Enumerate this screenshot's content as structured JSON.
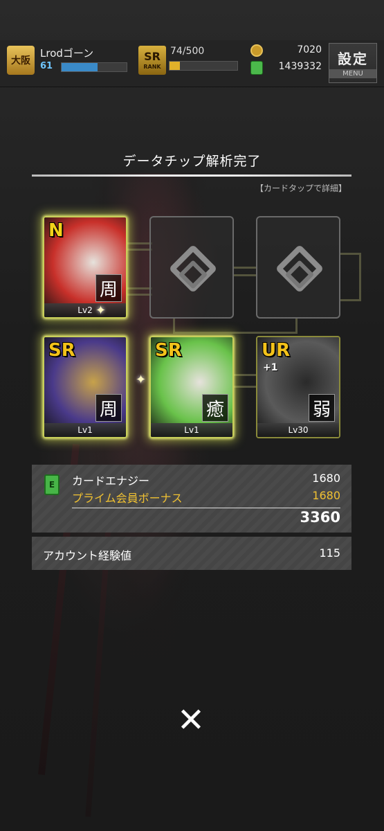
{
  "header": {
    "rank_badge": "大阪",
    "player_name": "Lrodゴーン",
    "level": "61",
    "xp_fraction": 0.55,
    "sr_rank": "SR",
    "sr_rank_sub": "RANK",
    "stamina": "74/500",
    "stamina_fraction": 0.15,
    "coins": "7020",
    "energy": "1439332",
    "settings_label": "設定",
    "menu_label": "MENU"
  },
  "title": "データチップ解析完了",
  "hint": "【カードタップで詳細】",
  "cards": [
    {
      "rarity": "N",
      "role": "周",
      "level": "Lv2",
      "rarity_color": "#f3d21a",
      "art_color": "#c8302a",
      "art_color2": "#e6e2dc"
    },
    {
      "rarity": "SR",
      "role": "周",
      "level": "Lv1",
      "rarity_color": "#f3c21a",
      "art_color": "#4a3a8a",
      "art_color2": "#c7a24a"
    },
    {
      "rarity": "SR",
      "role": "癒",
      "level": "Lv1",
      "rarity_color": "#f3c21a",
      "art_color": "#69c24a",
      "art_color2": "#e6e2dc"
    },
    {
      "rarity": "UR",
      "role": "弱",
      "level": "Lv30",
      "plus": "+1",
      "rarity_color": "#f3c21a",
      "art_color": "#5a5a5a",
      "art_color2": "#2a2a2a"
    }
  ],
  "results": {
    "card_energy_label": "カードエナジー",
    "card_energy_value": "1680",
    "prime_bonus_label": "プライム会員ボーナス",
    "prime_bonus_value": "1680",
    "total": "3360",
    "account_exp_label": "アカウント経験値",
    "account_exp_value": "115"
  },
  "close_symbol": "✕",
  "colors": {
    "accent_yellow": "#f0c132",
    "glow": "#e6f05a",
    "battery_green": "#47b547"
  }
}
